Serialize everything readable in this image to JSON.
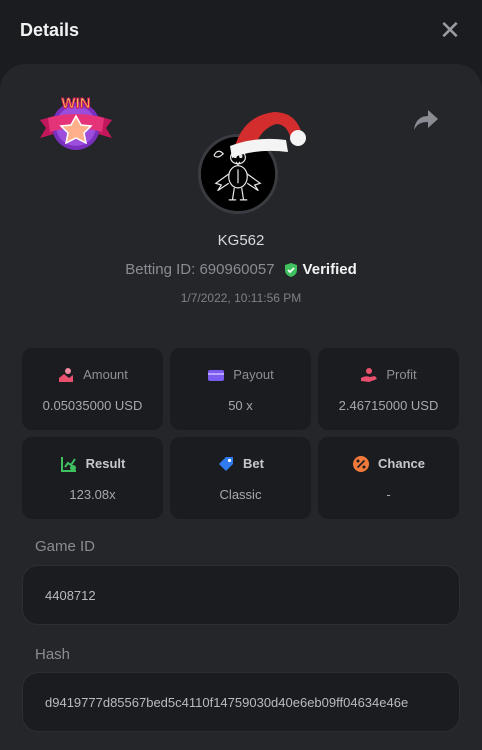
{
  "header": {
    "title": "Details",
    "close_icon": "close-icon"
  },
  "user": {
    "name": "KG562",
    "betting_id_label": "Betting ID: 690960057",
    "verified_label": "Verified",
    "datetime": "1/7/2022, 10:11:56 PM"
  },
  "badge": {
    "text": "WIN"
  },
  "stats": [
    {
      "label": "Amount",
      "value": "0.05035000 USD",
      "icon": "coins-icon",
      "color": "#e8506e"
    },
    {
      "label": "Payout",
      "value": "50 x",
      "icon": "wallet-icon",
      "color": "#7b5cf0"
    },
    {
      "label": "Profit",
      "value": "2.46715000 USD",
      "icon": "profit-hand-icon",
      "color": "#e8506e"
    },
    {
      "label": "Result",
      "value": "123.08x",
      "icon": "chart-check-icon",
      "color": "#3fc15f"
    },
    {
      "label": "Bet",
      "value": "Classic",
      "icon": "tag-icon",
      "color": "#2f7cf0"
    },
    {
      "label": "Chance",
      "value": "-",
      "icon": "percent-icon",
      "color": "#f07a3a"
    }
  ],
  "game": {
    "label": "Game ID",
    "value": "4408712"
  },
  "hash": {
    "label": "Hash",
    "value": "d9419777d85567bed5c4110f14759030d40e6eb09ff04634e46e"
  },
  "colors": {
    "background": "#1b1c1f",
    "panel": "#24262a",
    "verified": "#3fc15f"
  }
}
